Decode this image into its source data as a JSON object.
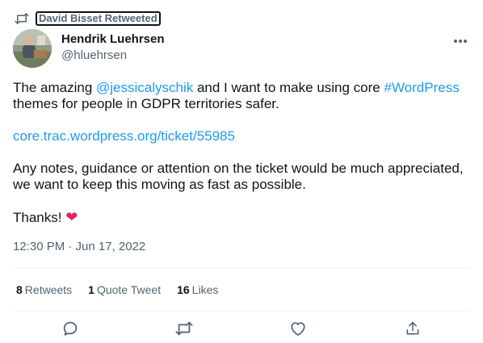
{
  "retweet_bar": {
    "icon": "retweet-icon",
    "label": "David Bisset Retweeted"
  },
  "author": {
    "name": "Hendrik Luehrsen",
    "handle": "@hluehrsen",
    "avatar": "avatar-photo"
  },
  "more_icon": "more-dots-icon",
  "tweet": {
    "line1_before": "The amazing ",
    "mention": "@jessicalyschik",
    "line1_middle": " and I want to make using core ",
    "hashtag": "#WordPress",
    "line1_after": " themes for people in GDPR territories safer.",
    "link": "core.trac.wordpress.org/ticket/55985",
    "paragraph3": "Any notes, guidance or attention on the ticket would be much appreciated, we want to keep this moving as fast as possible.",
    "thanks": "Thanks! ",
    "heart_emoji": "❤"
  },
  "timestamp": "12:30 PM · Jun 17, 2022",
  "stats": {
    "retweets_count": "8",
    "retweets_label": "Retweets",
    "quote_count": "1",
    "quote_label": "Quote Tweet",
    "likes_count": "16",
    "likes_label": "Likes"
  },
  "actions": [
    "reply-icon",
    "retweet-icon",
    "like-icon",
    "share-icon"
  ],
  "colors": {
    "text": "#0f1419",
    "secondary": "#536471",
    "link": "#1d9bf0",
    "heart": "#e0245e",
    "divider": "#eff3f4"
  }
}
